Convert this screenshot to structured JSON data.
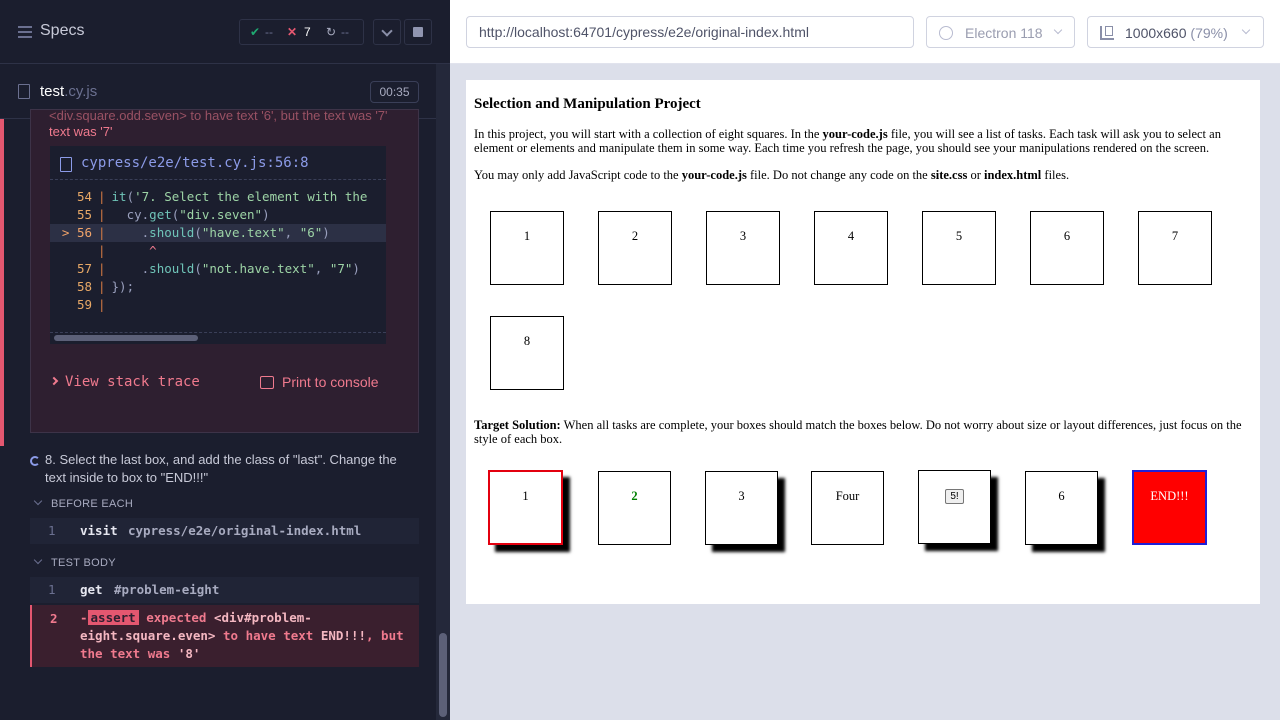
{
  "left": {
    "header": {
      "title": "Specs",
      "passed": "--",
      "failed": "7",
      "pending": "--"
    },
    "spec": {
      "name": "test",
      "ext": ".cy.js",
      "time": "00:35"
    },
    "error": {
      "message_tail": "<div.square.odd.seven> to have text '6', but the text was '7'",
      "codeframe_file": "cypress/e2e/test.cy.js:56:8",
      "lines": [
        {
          "num": "54",
          "code": "  it('7. Select the element with the"
        },
        {
          "num": "55",
          "code": "    cy.get(\"div.seven\")"
        },
        {
          "num": "> 56",
          "code": "      .should(\"have.text\", \"6\")"
        },
        {
          "num": "",
          "code": "       ^"
        },
        {
          "num": "57",
          "code": "      .should(\"not.have.text\", \"7\")"
        },
        {
          "num": "58",
          "code": "  });"
        },
        {
          "num": "59",
          "code": ""
        }
      ],
      "view_stack": "View stack trace",
      "print_console": "Print to console"
    },
    "test8": {
      "title": "8. Select the last box, and add the class of \"last\". Change the text inside to box to \"END!!!\"",
      "before_each": "BEFORE EACH",
      "test_body": "TEST BODY",
      "visit_num": "1",
      "visit_cmd": "visit",
      "visit_msg": "cypress/e2e/original-index.html",
      "get_num": "1",
      "get_cmd": "get",
      "get_msg": "#problem-eight",
      "assert_num": "2",
      "assert_badge": "assert",
      "assert_msg_1": "expected",
      "assert_msg_2": "<div#problem-eight.square.even>",
      "assert_msg_3": "to have text",
      "assert_msg_4": "END!!!",
      "assert_msg_5": ", but the text was",
      "assert_msg_6": "'8'"
    }
  },
  "right": {
    "url": "http://localhost:64701/cypress/e2e/original-index.html",
    "browser": "Electron 118",
    "viewport": "1000x660",
    "viewport_pct": "(79%)"
  },
  "page": {
    "title": "Selection and Manipulation Project",
    "intro_1": "In this project, you will start with a collection of eight squares. In the ",
    "intro_bold_1": "your-code.js",
    "intro_2": " file, you will see a list of tasks. Each task will ask you to select an element or elements and manipulate them in some way. Each time you refresh the page, you should see your manipulations rendered on the screen.",
    "note_1": "You may only add JavaScript code to the ",
    "note_bold_1": "your-code.js",
    "note_2": " file. Do not change any code on the ",
    "note_bold_2": "site.css",
    "note_3": " or ",
    "note_bold_3": "index.html",
    "note_4": " files.",
    "squares": [
      "1",
      "2",
      "3",
      "4",
      "5",
      "6",
      "7",
      "8"
    ],
    "target_bold": "Target Solution:",
    "target_text": " When all tasks are complete, your boxes should match the boxes below. Do not worry about size or layout differences, just focus on the style of each box.",
    "targets": [
      "1",
      "2",
      "3",
      "Four",
      "5!",
      "6",
      "END!!!"
    ]
  }
}
